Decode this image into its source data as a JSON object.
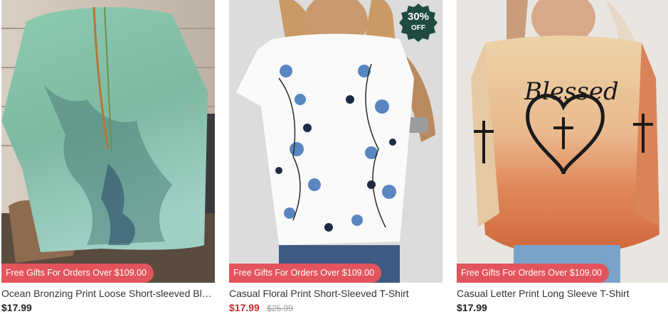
{
  "products": [
    {
      "title": "Ocean Bronzing Print Loose Short-sleeved Blo...",
      "price": "$17.99",
      "promo": "Free Gifts For Orders Over $109.00",
      "image": "teal-watercolor-blouse-photo"
    },
    {
      "title": "Casual Floral Print Short-Sleeved T-Shirt",
      "price": "$17.99",
      "original_price": "$25.99",
      "promo": "Free Gifts For Orders Over $109.00",
      "discount_badge": {
        "percent": "30%",
        "label": "OFF"
      },
      "image": "white-floral-tshirt-photo",
      "colors": {
        "sale_price": "#d8232a",
        "badge": "#1f4a3f"
      }
    },
    {
      "title": "Casual Letter Print Long Sleeve T-Shirt",
      "price": "$17.99",
      "promo": "Free Gifts For Orders Over $109.00",
      "image": "blessed-longsleeve-tshirt-photo",
      "graphic_text": "Blessed"
    }
  ],
  "colors": {
    "promo_bg": "#e4545c"
  }
}
